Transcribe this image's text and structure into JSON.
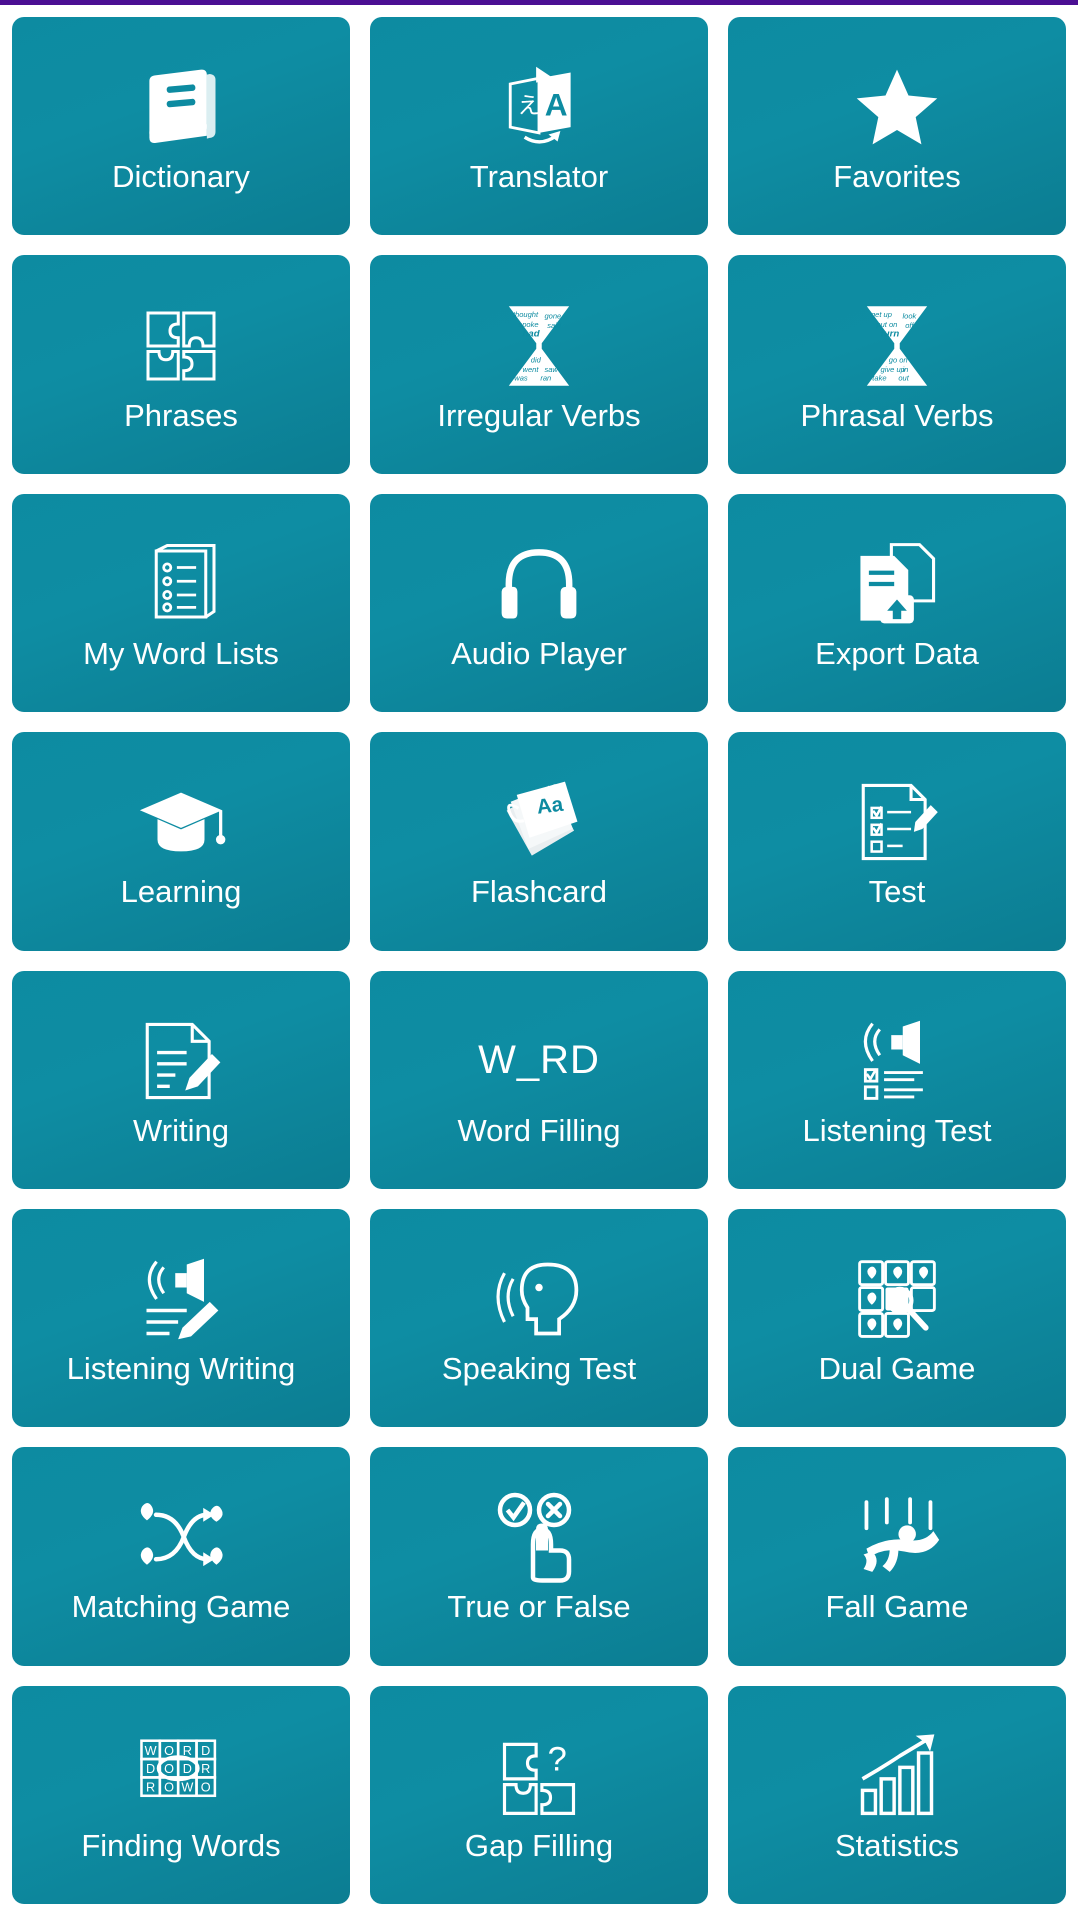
{
  "screen": {
    "background_color": "#ffffff",
    "status_bar_color": "#4b0f93",
    "tile_color": "#0d8ba1",
    "tile_text_color": "#ffffff",
    "columns": 3,
    "rows": 8
  },
  "tiles": [
    {
      "label": "Dictionary",
      "icon": "book-icon"
    },
    {
      "label": "Translator",
      "icon": "translate-icon"
    },
    {
      "label": "Favorites",
      "icon": "star-icon"
    },
    {
      "label": "Phrases",
      "icon": "puzzle-icon"
    },
    {
      "label": "Irregular Verbs",
      "icon": "hourglass-icon"
    },
    {
      "label": "Phrasal Verbs",
      "icon": "hourglass-icon"
    },
    {
      "label": "My Word Lists",
      "icon": "notebook-list-icon"
    },
    {
      "label": "Audio Player",
      "icon": "headphones-icon"
    },
    {
      "label": "Export Data",
      "icon": "export-document-icon"
    },
    {
      "label": "Learning",
      "icon": "graduation-cap-icon"
    },
    {
      "label": "Flashcard",
      "icon": "flashcard-icon",
      "icon_text": "Aa"
    },
    {
      "label": "Test",
      "icon": "checklist-pencil-icon"
    },
    {
      "label": "Writing",
      "icon": "document-pencil-icon"
    },
    {
      "label": "Word Filling",
      "icon": "word-blank-text-icon",
      "icon_text": "W_RD"
    },
    {
      "label": "Listening Test",
      "icon": "speaker-checklist-icon"
    },
    {
      "label": "Listening Writing",
      "icon": "speaker-pencil-icon"
    },
    {
      "label": "Speaking Test",
      "icon": "speaking-head-icon"
    },
    {
      "label": "Dual Game",
      "icon": "memory-grid-icon"
    },
    {
      "label": "Matching Game",
      "icon": "matching-arrows-icon"
    },
    {
      "label": "True or False",
      "icon": "true-false-hand-icon"
    },
    {
      "label": "Fall Game",
      "icon": "falling-person-icon"
    },
    {
      "label": "Finding Words",
      "icon": "word-search-grid-icon",
      "icon_text": "WORD"
    },
    {
      "label": "Gap Filling",
      "icon": "puzzle-question-icon"
    },
    {
      "label": "Statistics",
      "icon": "bar-chart-arrow-icon"
    }
  ]
}
